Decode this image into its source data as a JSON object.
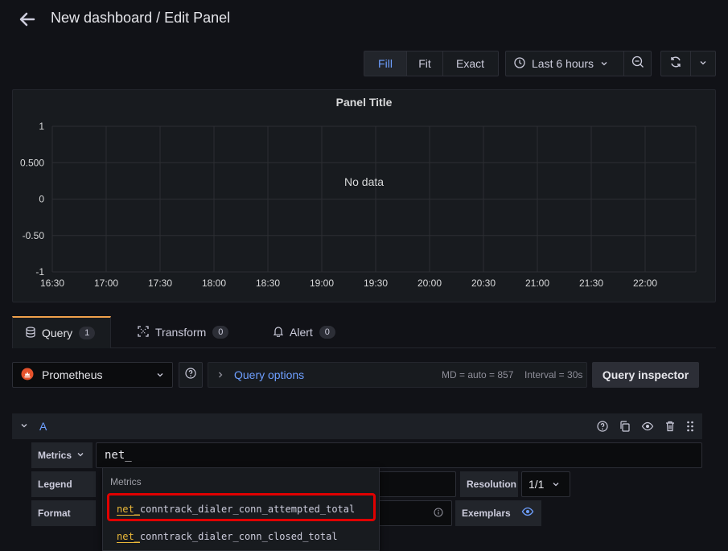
{
  "header": {
    "title": "New dashboard / Edit Panel"
  },
  "toolbar": {
    "view_modes": [
      "Fill",
      "Fit",
      "Exact"
    ],
    "active_view_mode": "Fill",
    "time_range": "Last 6 hours"
  },
  "panel": {
    "title": "Panel Title",
    "no_data": "No data"
  },
  "chart_data": {
    "type": "line",
    "title": "Panel Title",
    "x_ticks": [
      "16:30",
      "17:00",
      "17:30",
      "18:00",
      "18:30",
      "19:00",
      "19:30",
      "20:00",
      "20:30",
      "21:00",
      "21:30",
      "22:00"
    ],
    "y_ticks": [
      "1",
      "0.500",
      "0",
      "-0.50",
      "-1"
    ],
    "ylim": [
      -1,
      1
    ],
    "series": [],
    "annotation": "No data",
    "grid": true
  },
  "tabs": [
    {
      "label": "Query",
      "count": "1"
    },
    {
      "label": "Transform",
      "count": "0"
    },
    {
      "label": "Alert",
      "count": "0"
    }
  ],
  "query_row": {
    "datasource": "Prometheus",
    "query_options": "Query options",
    "md": "MD = auto = 857",
    "interval": "Interval = 30s",
    "inspector": "Query inspector"
  },
  "query_a": {
    "ref": "A",
    "metrics_label": "Metrics",
    "metrics_value": "net_",
    "legend_label": "Legend",
    "format_label": "Format",
    "resolution_label": "Resolution",
    "resolution_value": "1/1",
    "exemplars_label": "Exemplars"
  },
  "dropdown": {
    "header": "Metrics",
    "match": "net_",
    "items": [
      {
        "match": "net_",
        "rest": "conntrack_dialer_conn_attempted_total"
      },
      {
        "match": "net_",
        "rest": "conntrack_dialer_conn_closed_total"
      }
    ]
  },
  "colors": {
    "accent_blue": "#6e9fff",
    "active_tab": "#f0a04b",
    "match_highlight": "#eab839",
    "annotation_red": "#e00000"
  }
}
